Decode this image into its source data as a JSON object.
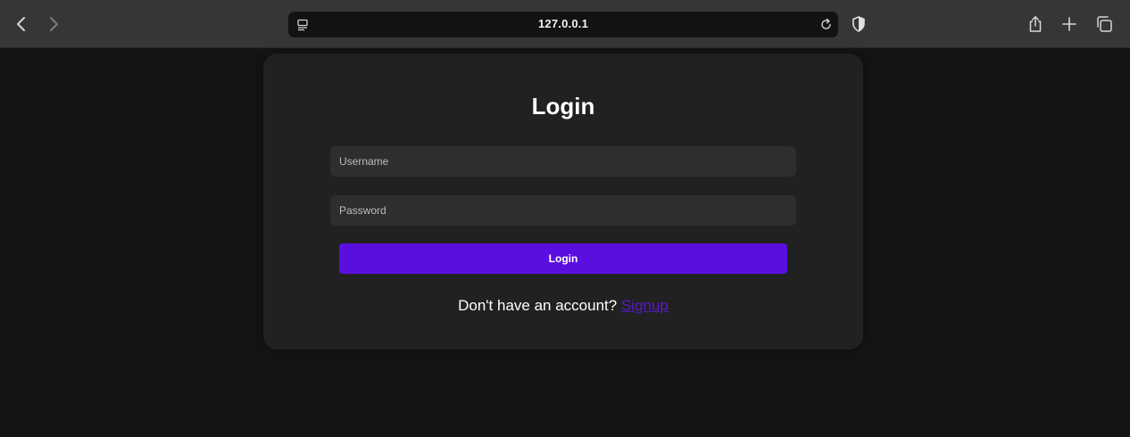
{
  "browser": {
    "url": "127.0.0.1",
    "icons": [
      "back-icon",
      "forward-icon",
      "reader-icon",
      "reload-icon",
      "shield-icon",
      "share-icon",
      "new-tab-icon",
      "tabs-icon"
    ]
  },
  "login": {
    "title": "Login",
    "username_placeholder": "Username",
    "password_placeholder": "Password",
    "button_label": "Login",
    "signup_prompt": "Don't have an account?",
    "signup_link": "Signup"
  },
  "colors": {
    "accent": "#5a0fe0",
    "link": "#5a18c9",
    "background": "#141414",
    "card": "#212121"
  }
}
